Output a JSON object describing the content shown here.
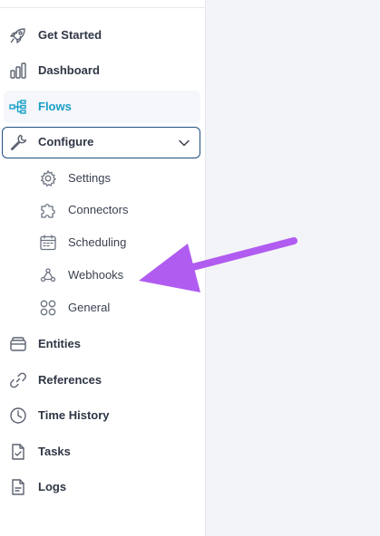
{
  "nav": {
    "get_started": "Get Started",
    "dashboard": "Dashboard",
    "flows": "Flows",
    "configure": "Configure",
    "entities": "Entities",
    "references": "References",
    "time_history": "Time History",
    "tasks": "Tasks",
    "logs": "Logs"
  },
  "configure_sub": {
    "settings": "Settings",
    "connectors": "Connectors",
    "scheduling": "Scheduling",
    "webhooks": "Webhooks",
    "general": "General"
  },
  "icons": {
    "get_started": "rocket-icon",
    "dashboard": "bar-chart-icon",
    "flows": "flow-tree-icon",
    "configure": "wrench-icon",
    "settings": "gear-icon",
    "connectors": "puzzle-icon",
    "scheduling": "calendar-icon",
    "webhooks": "webhook-icon",
    "general": "grid-icon",
    "entities": "database-icon",
    "references": "link-icon",
    "time_history": "clock-icon",
    "tasks": "document-check-icon",
    "logs": "document-icon"
  },
  "colors": {
    "active_text": "#1aa0c8",
    "configure_border": "#1f4f7e",
    "annotation_arrow": "#b05cf0"
  }
}
